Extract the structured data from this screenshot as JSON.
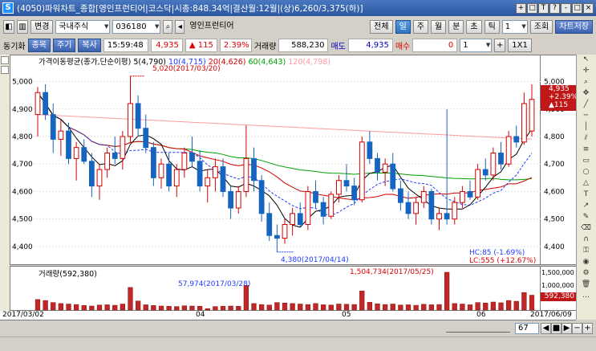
{
  "window": {
    "title": "(4050)파워차트_종합[영인프런티어|코스닥|시총:848.34억|결산월:12월|(상)6,260/3,375(하)]",
    "buttons": [
      "+",
      "□",
      "T",
      "?",
      "-",
      "□",
      "×"
    ]
  },
  "toolbar": {
    "change_label": "변경",
    "market": "국내주식",
    "code": "036180",
    "stock_name": "영인프런티어",
    "view_buttons": [
      "전체",
      "일",
      "주",
      "월",
      "분",
      "초",
      "틱"
    ],
    "period_value": "1",
    "query_label": "조회",
    "save_label": "차트저장"
  },
  "inforow": {
    "sync_label": "동기화",
    "tabs": [
      "종목",
      "주기",
      "복사"
    ],
    "time": "15:59:48",
    "price": "4,935",
    "change_arrow": "▲",
    "change": "115",
    "change_pct": "2.39%",
    "volume_label": "거래량",
    "volume": "588,230",
    "sell_label": "매도",
    "sell_value": "4,935",
    "buy_label": "매수",
    "buy_value": "0",
    "right_value": "1",
    "scale_label": "1X1"
  },
  "legend": {
    "title": "가격이동평균(종가,단순이평)",
    "ma5": "5(4,790)",
    "ma10": "10(4,715)",
    "ma20": "20(4,626)",
    "ma60": "60(4,643)",
    "ma120": "120(4,798)"
  },
  "annotations": {
    "high": "5,020(2017/03/20)",
    "low": "4,380(2017/04/14)",
    "hc": "HC:85 (-1.69%)",
    "lc": "LC:555 (+12.67%)",
    "price_box": [
      "4,935",
      "+2.39%",
      "▲115"
    ],
    "vol_legend": "거래량(592,380)",
    "vol_low": "57,974(2017/03/28)",
    "vol_high": "1,504,734(2017/05/25)",
    "vol_box": "592,380"
  },
  "yaxis": {
    "price_ticks": [
      "5,000",
      "4,900",
      "4,800",
      "4,700",
      "4,600",
      "4,500",
      "4,400"
    ],
    "volume_ticks": [
      "1,500,000",
      "1,000,000",
      "500,000"
    ]
  },
  "xaxis": {
    "ticks": [
      "2017/03/02",
      "04",
      "05",
      "06",
      "2017/06/09"
    ]
  },
  "bottom": {
    "count_value": "67"
  },
  "colors": {
    "up": "#d40000",
    "down": "#1565c0",
    "ma5": "#000000",
    "ma10": "#1e3cff",
    "ma20": "#d40000",
    "ma60": "#00a000",
    "ma120": "#ff9aa0",
    "volume": "#c02828"
  },
  "chart_data": {
    "type": "candlestick",
    "date_range": [
      "2017/03/02",
      "2017/06/09"
    ],
    "ylim": [
      4350,
      5060
    ],
    "candles": [
      [
        4880,
        4980,
        4800,
        4960
      ],
      [
        4960,
        4990,
        4860,
        4880
      ],
      [
        4880,
        4920,
        4740,
        4790
      ],
      [
        4790,
        4860,
        4730,
        4820
      ],
      [
        4820,
        4850,
        4700,
        4720
      ],
      [
        4720,
        4780,
        4640,
        4760
      ],
      [
        4760,
        4790,
        4700,
        4710
      ],
      [
        4710,
        4740,
        4580,
        4620
      ],
      [
        4620,
        4700,
        4570,
        4680
      ],
      [
        4680,
        4760,
        4650,
        4740
      ],
      [
        4740,
        4800,
        4700,
        4720
      ],
      [
        4720,
        4820,
        4680,
        4800
      ],
      [
        4800,
        5020,
        4780,
        4920
      ],
      [
        4920,
        4950,
        4800,
        4830
      ],
      [
        4830,
        4880,
        4740,
        4760
      ],
      [
        4760,
        4780,
        4620,
        4650
      ],
      [
        4650,
        4720,
        4610,
        4700
      ],
      [
        4700,
        4740,
        4600,
        4620
      ],
      [
        4620,
        4700,
        4580,
        4680
      ],
      [
        4680,
        4760,
        4650,
        4740
      ],
      [
        4740,
        4800,
        4690,
        4710
      ],
      [
        4710,
        4750,
        4600,
        4620
      ],
      [
        4620,
        4680,
        4560,
        4650
      ],
      [
        4650,
        4720,
        4600,
        4690
      ],
      [
        4690,
        4720,
        4580,
        4600
      ],
      [
        4600,
        4620,
        4500,
        4540
      ],
      [
        4540,
        4620,
        4520,
        4600
      ],
      [
        4600,
        4840,
        4580,
        4720
      ],
      [
        4720,
        4760,
        4600,
        4640
      ],
      [
        4640,
        4660,
        4490,
        4520
      ],
      [
        4520,
        4560,
        4420,
        4440
      ],
      [
        4440,
        4480,
        4380,
        4430
      ],
      [
        4430,
        4500,
        4410,
        4480
      ],
      [
        4480,
        4540,
        4440,
        4520
      ],
      [
        4520,
        4560,
        4470,
        4480
      ],
      [
        4480,
        4620,
        4460,
        4600
      ],
      [
        4600,
        4640,
        4540,
        4560
      ],
      [
        4560,
        4580,
        4480,
        4510
      ],
      [
        4510,
        4600,
        4500,
        4590
      ],
      [
        4590,
        4660,
        4560,
        4640
      ],
      [
        4640,
        4700,
        4600,
        4620
      ],
      [
        4620,
        4650,
        4550,
        4570
      ],
      [
        4570,
        4800,
        4560,
        4780
      ],
      [
        4780,
        4820,
        4700,
        4720
      ],
      [
        4720,
        4740,
        4640,
        4670
      ],
      [
        4670,
        4720,
        4620,
        4700
      ],
      [
        4700,
        4740,
        4600,
        4610
      ],
      [
        4610,
        4640,
        4530,
        4560
      ],
      [
        4560,
        4600,
        4500,
        4520
      ],
      [
        4520,
        4580,
        4480,
        4560
      ],
      [
        4560,
        4620,
        4540,
        4600
      ],
      [
        4600,
        4610,
        4480,
        4500
      ],
      [
        4500,
        4540,
        4460,
        4520
      ],
      [
        4520,
        4900,
        4480,
        4500
      ],
      [
        4500,
        4580,
        4480,
        4560
      ],
      [
        4560,
        4620,
        4540,
        4600
      ],
      [
        4600,
        4640,
        4570,
        4580
      ],
      [
        4580,
        4700,
        4570,
        4680
      ],
      [
        4680,
        4720,
        4640,
        4660
      ],
      [
        4660,
        4760,
        4640,
        4740
      ],
      [
        4740,
        4780,
        4680,
        4700
      ],
      [
        4700,
        4820,
        4690,
        4800
      ],
      [
        4800,
        4840,
        4760,
        4780
      ],
      [
        4780,
        4960,
        4770,
        4920
      ],
      [
        4820,
        4990,
        4800,
        4935
      ]
    ],
    "volumes": [
      420,
      380,
      300,
      260,
      240,
      220,
      180,
      160,
      200,
      210,
      190,
      240,
      900,
      360,
      210,
      180,
      160,
      150,
      140,
      170,
      160,
      150,
      58,
      140,
      150,
      160,
      150,
      980,
      260,
      220,
      200,
      300,
      280,
      260,
      240,
      220,
      260,
      210,
      200,
      240,
      230,
      220,
      760,
      310,
      250,
      220,
      240,
      200,
      210,
      190,
      230,
      210,
      220,
      1505,
      260,
      240,
      210,
      300,
      280,
      320,
      290,
      380,
      350,
      700,
      592
    ]
  }
}
